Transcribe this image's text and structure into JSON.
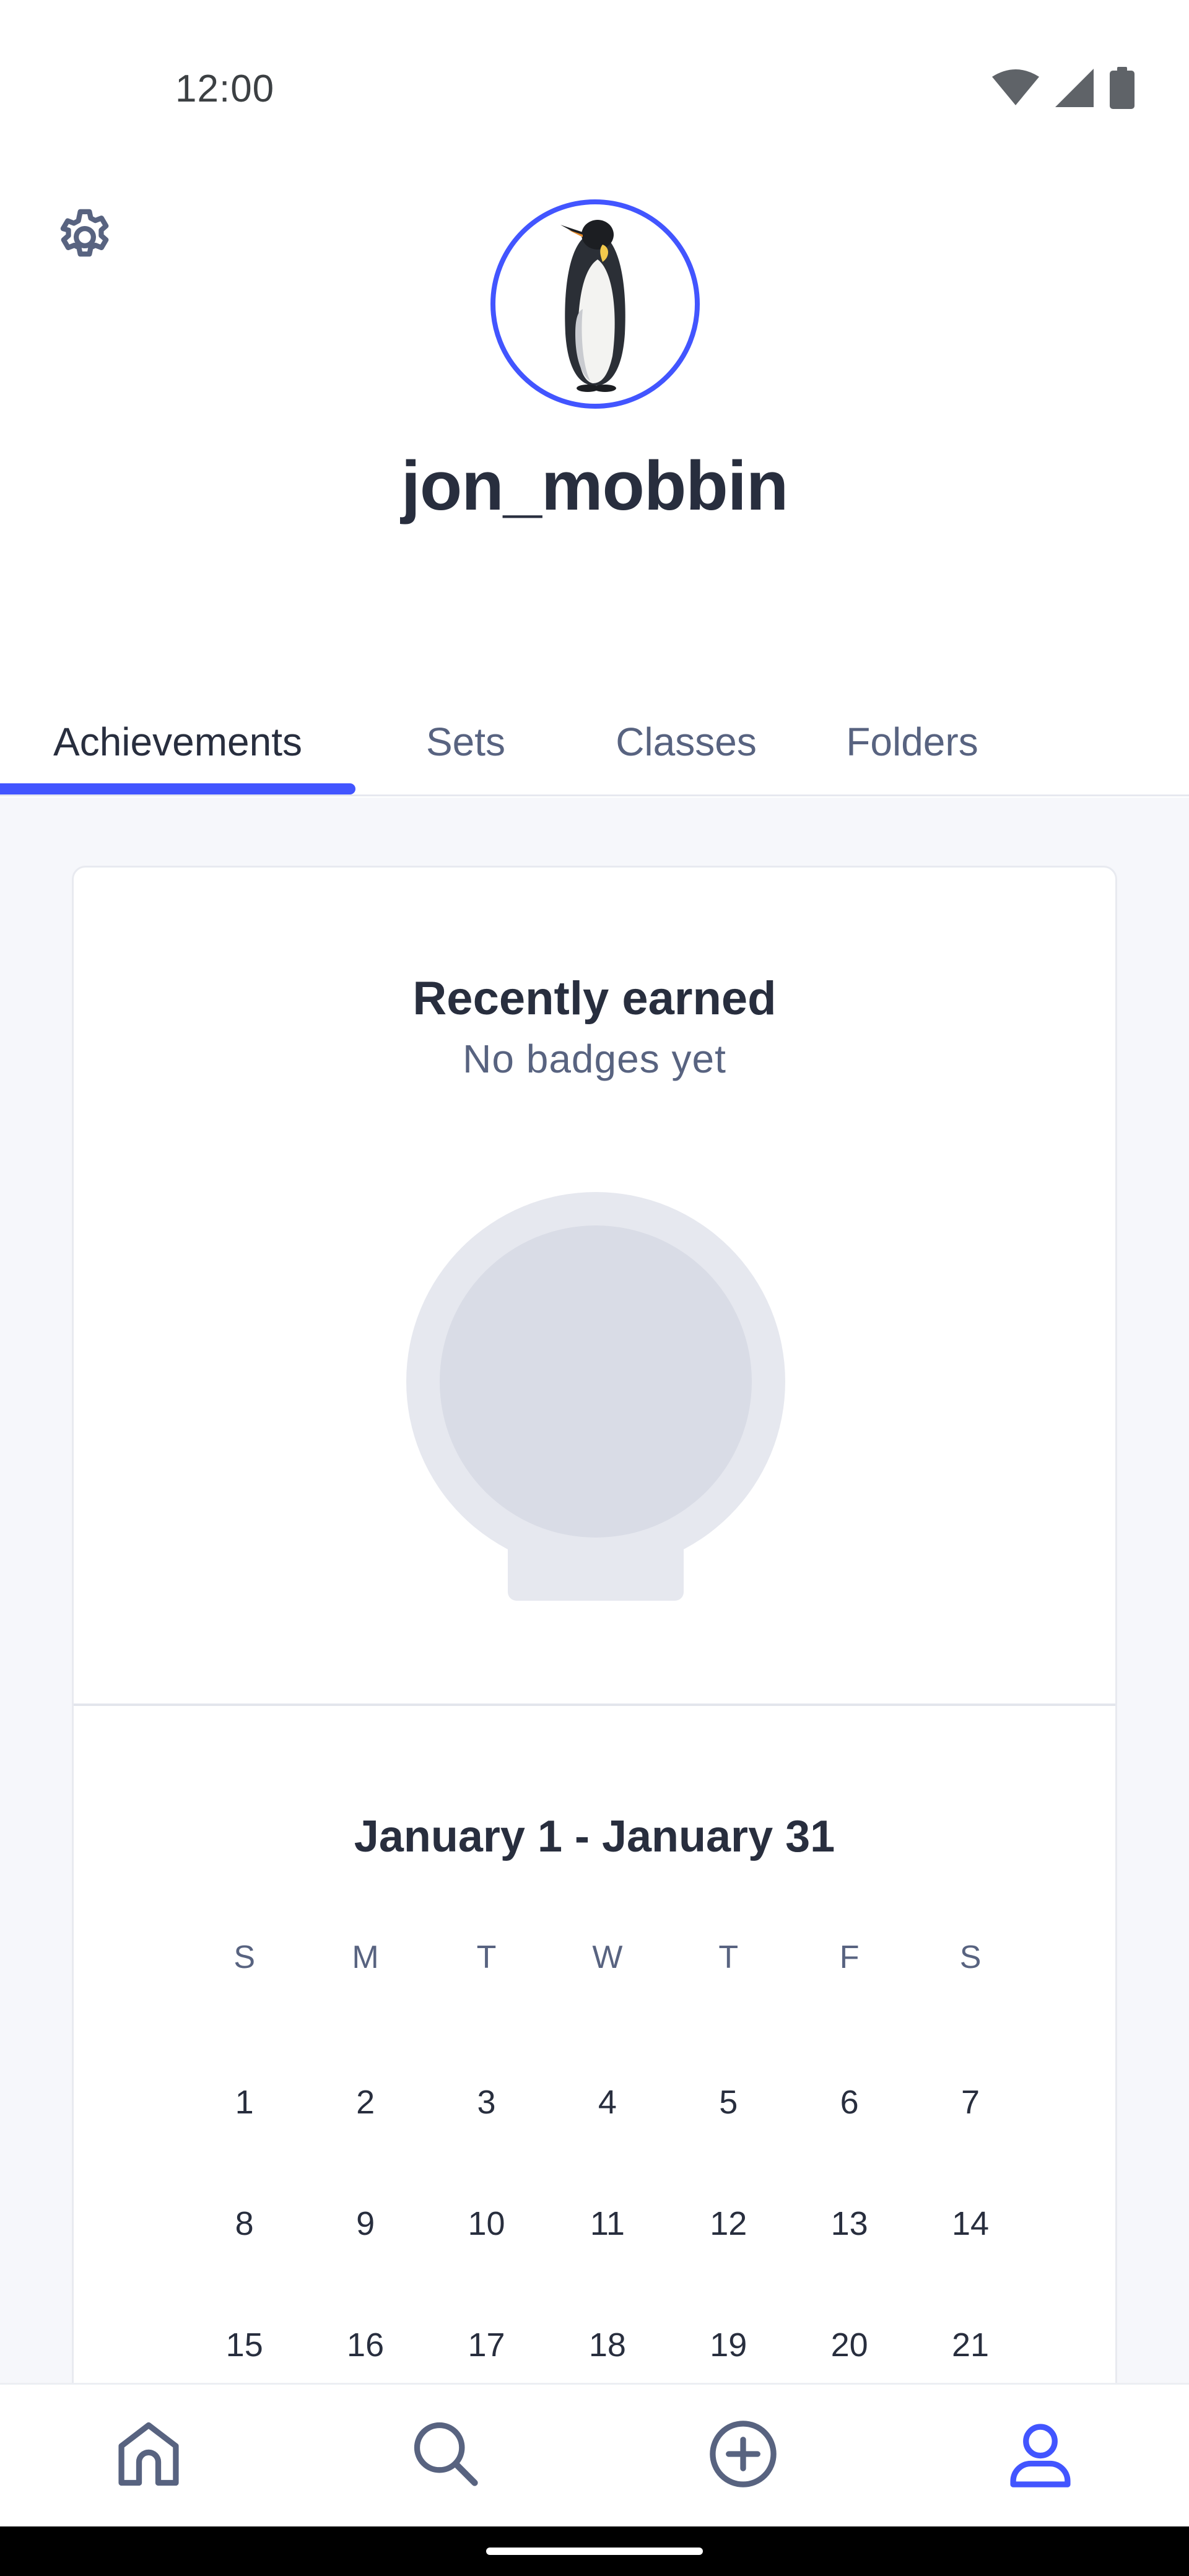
{
  "status_bar": {
    "time": "12:00",
    "icons": [
      "wifi-icon",
      "cellular-signal-icon",
      "battery-icon"
    ]
  },
  "header": {
    "settings_icon": "gear-icon",
    "avatar_icon": "penguin-avatar",
    "username": "jon_mobbin"
  },
  "tabs": [
    {
      "label": "Achievements",
      "active": true
    },
    {
      "label": "Sets",
      "active": false
    },
    {
      "label": "Classes",
      "active": false
    },
    {
      "label": "Folders",
      "active": false
    }
  ],
  "achievements": {
    "recent_title": "Recently earned",
    "recent_subtitle": "No badges yet",
    "calendar": {
      "title": "January 1 - January 31",
      "weekdays": [
        "S",
        "M",
        "T",
        "W",
        "T",
        "F",
        "S"
      ],
      "weeks": [
        [
          "1",
          "2",
          "3",
          "4",
          "5",
          "6",
          "7"
        ],
        [
          "8",
          "9",
          "10",
          "11",
          "12",
          "13",
          "14"
        ],
        [
          "15",
          "16",
          "17",
          "18",
          "19",
          "20",
          "21"
        ]
      ]
    }
  },
  "bottom_nav": [
    {
      "icon": "home-icon",
      "active": false
    },
    {
      "icon": "search-icon",
      "active": false
    },
    {
      "icon": "plus-circle-icon",
      "active": false
    },
    {
      "icon": "profile-icon",
      "active": true
    }
  ],
  "colors": {
    "accent": "#4255ff",
    "text_primary": "#282e3e",
    "text_secondary": "#586380",
    "background": "#f6f7fb",
    "placeholder_badge": "#d9dce6"
  }
}
